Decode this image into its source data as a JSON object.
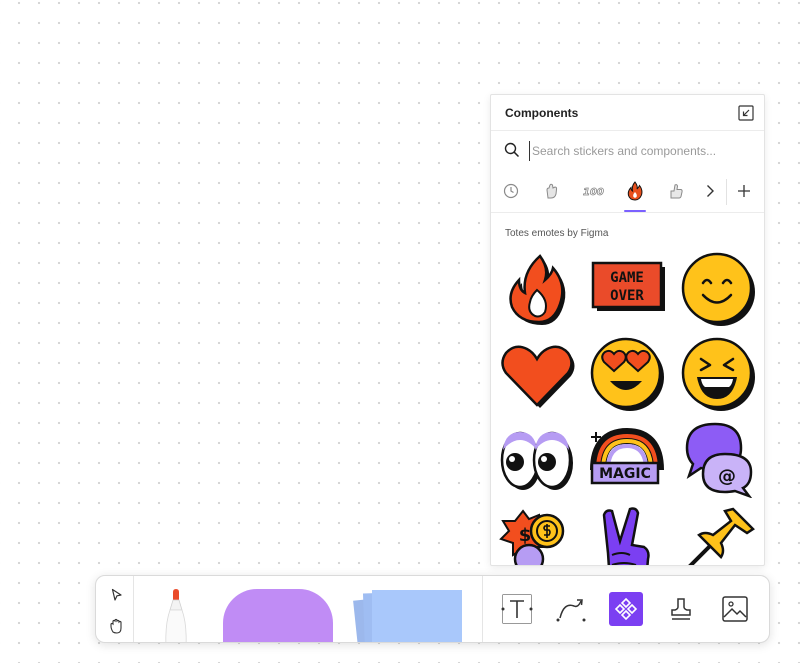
{
  "panel": {
    "title": "Components",
    "collapse_icon": "collapse-arrow-icon",
    "search": {
      "placeholder": "Search stickers and components...",
      "value": ""
    },
    "tabs": [
      {
        "name": "recent",
        "icon": "clock-icon"
      },
      {
        "name": "hands",
        "icon": "hand-sticker-icon"
      },
      {
        "name": "100",
        "icon": "hundred-sticker-icon"
      },
      {
        "name": "fire",
        "icon": "fire-sticker-icon",
        "selected": true
      },
      {
        "name": "thumbs",
        "icon": "thumbs-sticker-icon"
      }
    ],
    "section_label": "Totes emotes by Figma",
    "stickers": [
      {
        "name": "fire",
        "icon": "fire-sticker"
      },
      {
        "name": "game-over",
        "icon": "game-over-sticker",
        "line1": "GAME",
        "line2": "OVER"
      },
      {
        "name": "smile",
        "icon": "smile-sticker"
      },
      {
        "name": "heart",
        "icon": "heart-sticker"
      },
      {
        "name": "heart-eyes",
        "icon": "heart-eyes-sticker"
      },
      {
        "name": "laughing",
        "icon": "laughing-sticker"
      },
      {
        "name": "eyes",
        "icon": "eyes-sticker"
      },
      {
        "name": "magic",
        "icon": "magic-rainbow-sticker",
        "text": "MAGIC"
      },
      {
        "name": "mention",
        "icon": "mention-bubble-sticker",
        "text": "@"
      },
      {
        "name": "money",
        "icon": "money-sticker",
        "text": "$"
      },
      {
        "name": "peace",
        "icon": "peace-hand-sticker"
      },
      {
        "name": "pin",
        "icon": "push-pin-sticker"
      }
    ]
  },
  "toolbar": {
    "tools": [
      {
        "name": "move",
        "icon": "cursor-icon"
      },
      {
        "name": "hand",
        "icon": "hand-icon"
      },
      {
        "name": "marker",
        "icon": "marker-icon"
      },
      {
        "name": "shape",
        "icon": "shape-icon"
      },
      {
        "name": "sticky",
        "icon": "sticky-note-icon"
      },
      {
        "name": "text",
        "icon": "text-tool-icon"
      },
      {
        "name": "connector",
        "icon": "connector-icon"
      },
      {
        "name": "widgets",
        "icon": "widgets-icon",
        "selected": true
      },
      {
        "name": "stamp",
        "icon": "stamp-icon"
      },
      {
        "name": "image",
        "icon": "image-icon"
      }
    ],
    "colors": {
      "accent": "#7b3ff2",
      "shape": "#c08cf5",
      "sticky": "#a9c8fb",
      "marker_tip": "#ea4b2a"
    }
  }
}
